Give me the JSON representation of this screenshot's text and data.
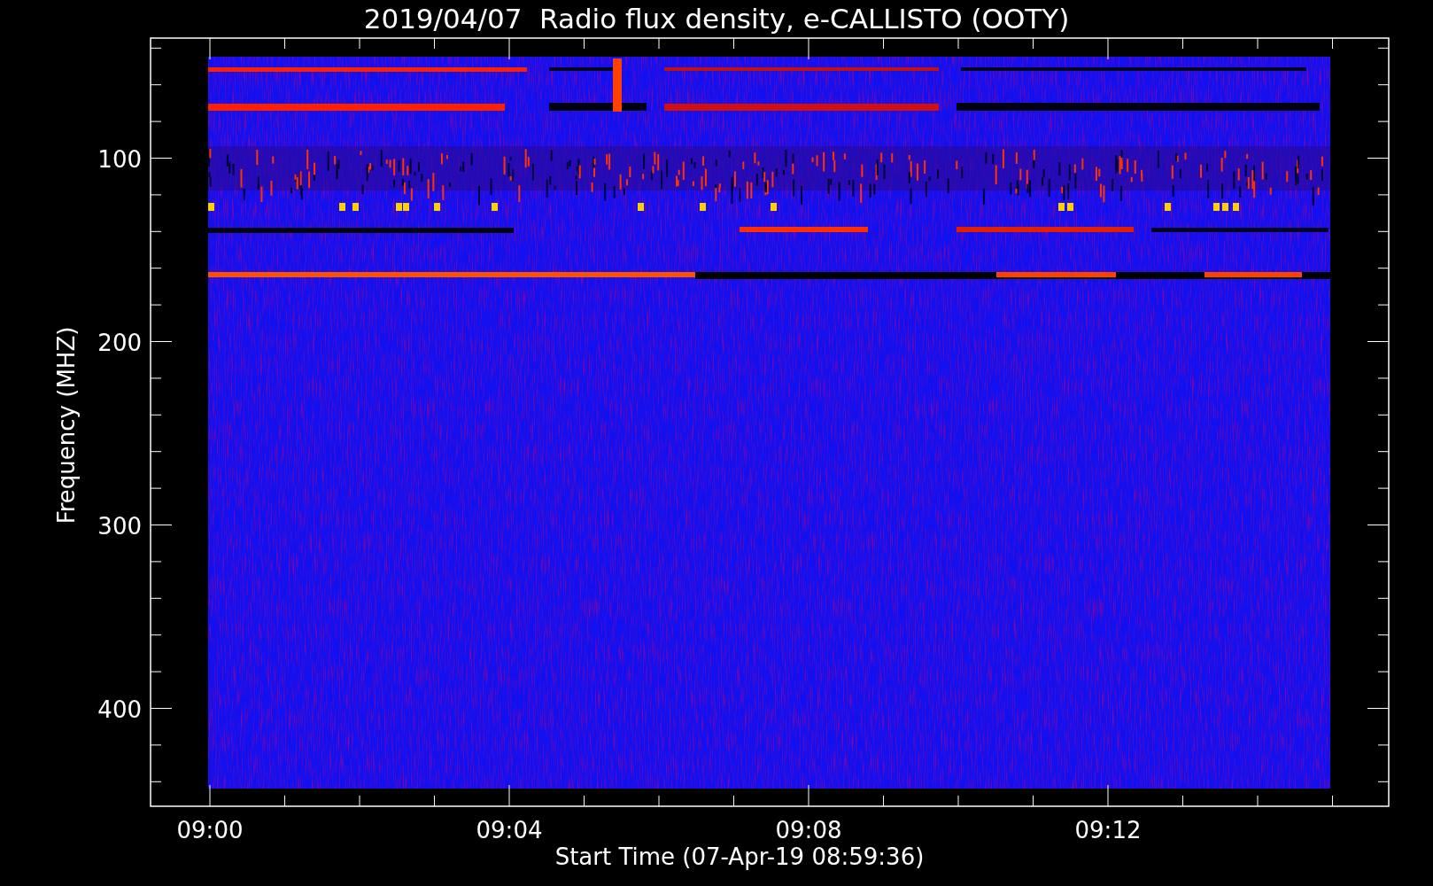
{
  "title": "2019/04/07  Radio flux density, e-CALLISTO (OOTY)",
  "y_axis": {
    "label": "Frequency (MHZ)",
    "ticks": [
      "100",
      "200",
      "300",
      "400"
    ]
  },
  "x_axis": {
    "label": "Start Time (07-Apr-19 08:59:36)",
    "ticks": [
      "09:00",
      "09:04",
      "09:08",
      "09:12"
    ]
  }
}
